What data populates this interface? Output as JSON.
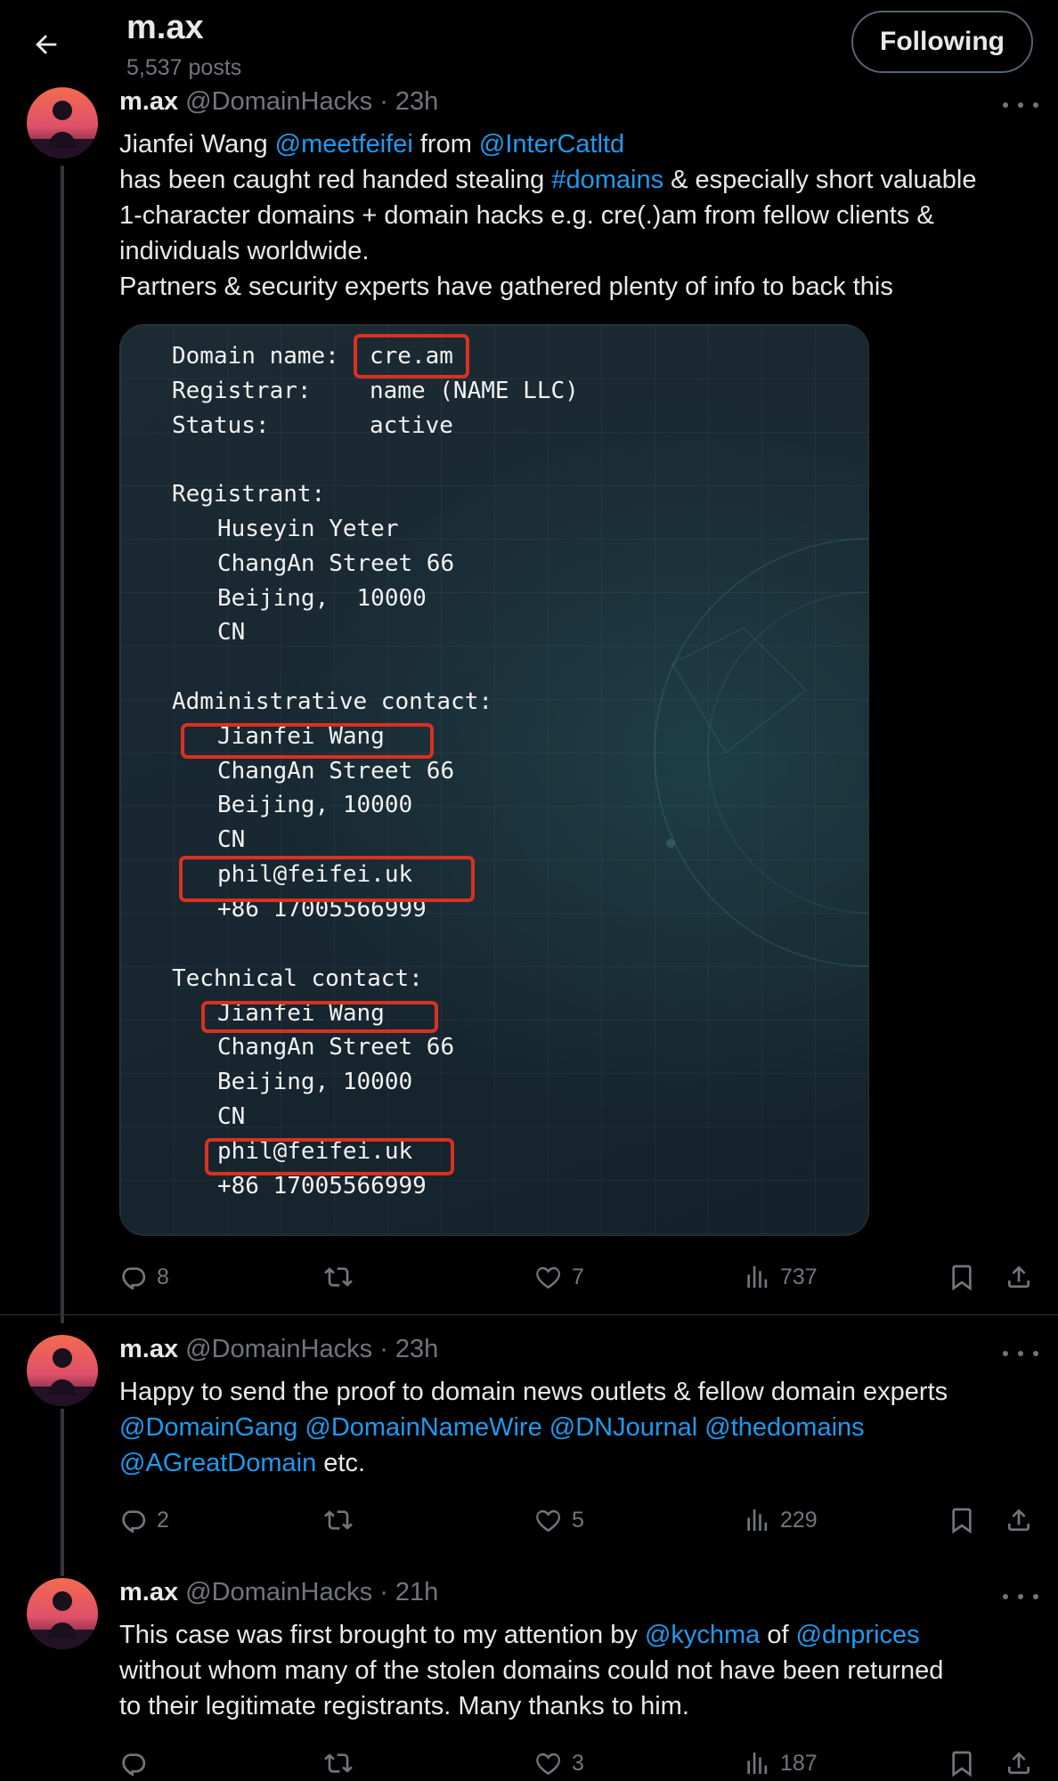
{
  "header": {
    "title": "m.ax",
    "post_count": "5,537 posts",
    "follow_label": "Following"
  },
  "tweets": [
    {
      "name": "m.ax",
      "handle": "@DomainHacks",
      "time": "· 23h",
      "lines": [
        [
          {
            "t": "Jianfei Wang "
          },
          {
            "t": "@meetfeifei",
            "link": true
          },
          {
            "t": " from "
          },
          {
            "t": "@InterCatltd",
            "link": true
          }
        ],
        [
          {
            "t": "has been caught red handed stealing "
          },
          {
            "t": "#domains",
            "link": true
          },
          {
            "t": " & especially short valuable"
          }
        ],
        [
          {
            "t": "1-character domains + domain hacks e.g. cre(.)am from fellow clients &"
          }
        ],
        [
          {
            "t": "individuals worldwide."
          }
        ],
        [
          {
            "t": "Partners & security experts have gathered plenty of info to back this"
          }
        ]
      ],
      "replies": "8",
      "reposts": "",
      "likes": "7",
      "views": "737"
    },
    {
      "name": "m.ax",
      "handle": "@DomainHacks",
      "time": "· 23h",
      "lines": [
        [
          {
            "t": "Happy to send the proof to domain news outlets & fellow domain experts"
          }
        ],
        [
          {
            "t": "@DomainGang",
            "link": true
          },
          {
            "t": " "
          },
          {
            "t": "@DomainNameWire",
            "link": true
          },
          {
            "t": " "
          },
          {
            "t": "@DNJournal",
            "link": true
          },
          {
            "t": " "
          },
          {
            "t": "@thedomains",
            "link": true
          }
        ],
        [
          {
            "t": "@AGreatDomain",
            "link": true
          },
          {
            "t": " etc."
          }
        ]
      ],
      "replies": "2",
      "reposts": "",
      "likes": "5",
      "views": "229"
    },
    {
      "name": "m.ax",
      "handle": "@DomainHacks",
      "time": "· 21h",
      "lines": [
        [
          {
            "t": "This case was first brought to my attention by "
          },
          {
            "t": "@kychma",
            "link": true
          },
          {
            "t": " of "
          },
          {
            "t": "@dnprices",
            "link": true
          }
        ],
        [
          {
            "t": "without whom many of the stolen domains could not have been returned"
          }
        ],
        [
          {
            "t": "to their legitimate registrants. Many thanks to him."
          }
        ]
      ],
      "replies": "",
      "reposts": "",
      "likes": "3",
      "views": "187"
    }
  ],
  "whois": {
    "domain_label": "Domain name:",
    "domain": "cre.am",
    "registrar_label": "Registrar:",
    "registrar": "name (NAME LLC)",
    "status_label": "Status:",
    "status": "active",
    "registrant_label": "Registrant:",
    "registrant_name": "Huseyin Yeter",
    "registrant_street": "ChangAn Street 66",
    "registrant_city": "Beijing,  10000",
    "registrant_country": "CN",
    "admin_label": "Administrative contact:",
    "admin_name": "Jianfei Wang",
    "admin_street": "ChangAn Street 66",
    "admin_city": "Beijing, 10000",
    "admin_country": "CN",
    "admin_email": "phil@feifei.uk",
    "admin_phone": "+86 17005566999",
    "tech_label": "Technical contact:",
    "tech_name": "Jianfei Wang",
    "tech_street": "ChangAn Street 66",
    "tech_city": "Beijing, 10000",
    "tech_country": "CN",
    "tech_email": "phil@feifei.uk",
    "tech_phone": "+86 17005566999"
  },
  "colors": {
    "link": "#1d9bf0",
    "highlight_box": "#d9311f",
    "muted": "#71767b"
  },
  "icons": [
    "back-arrow-icon",
    "more-icon",
    "reply-icon",
    "repost-icon",
    "like-icon",
    "views-icon",
    "bookmark-icon",
    "share-icon"
  ]
}
